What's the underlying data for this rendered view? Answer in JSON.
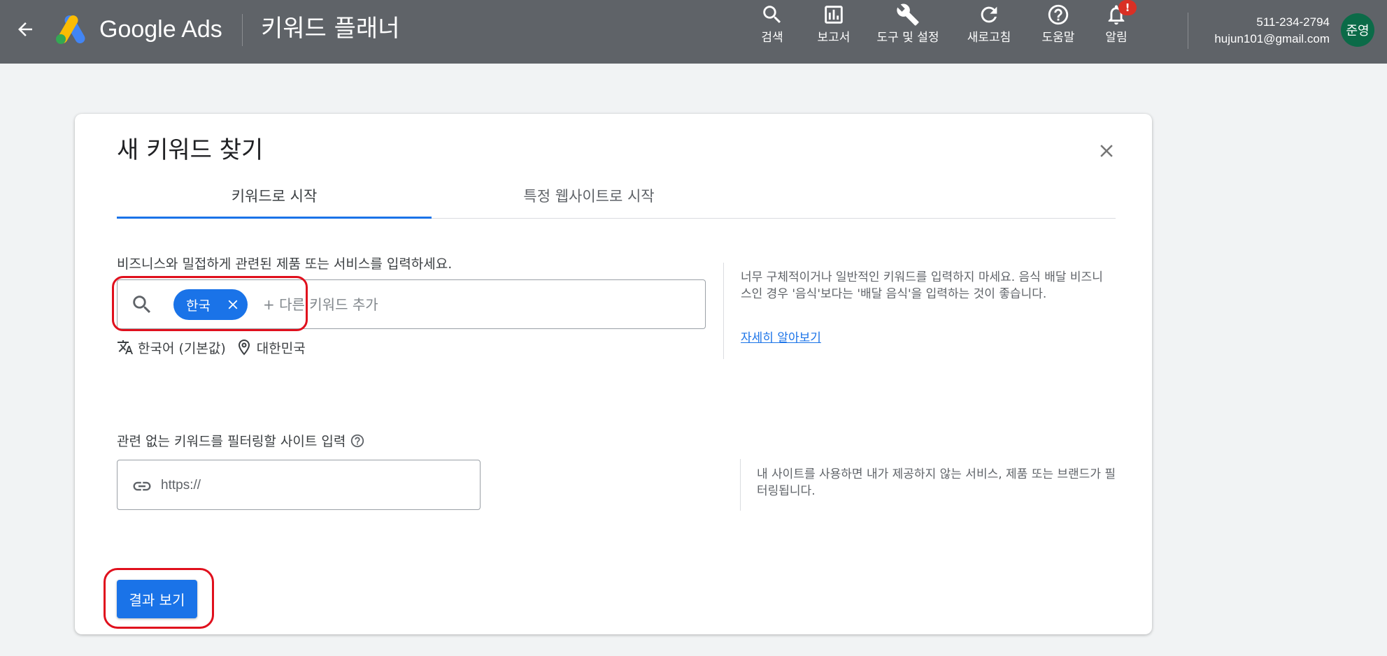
{
  "topbar": {
    "brand": "Google Ads",
    "product": "키워드 플래너",
    "tools": [
      {
        "label": "검색",
        "icon": "search-icon"
      },
      {
        "label": "보고서",
        "icon": "reports-icon"
      },
      {
        "label": "도구 및 설정",
        "icon": "wrench-icon"
      },
      {
        "label": "새로고침",
        "icon": "refresh-icon"
      },
      {
        "label": "도움말",
        "icon": "help-icon"
      },
      {
        "label": "알림",
        "icon": "bell-icon"
      }
    ],
    "alert_badge": "!",
    "account_phone": "511-234-2794",
    "account_email": "hujun101@gmail.com",
    "avatar_text": "준영",
    "colors": {
      "bar": "#5f6368",
      "avatar": "#0b6b48",
      "badge": "#d93025"
    }
  },
  "dialog": {
    "title": "새 키워드 찾기",
    "tabs": [
      {
        "label": "키워드로 시작",
        "active": true
      },
      {
        "label": "특정 웹사이트로 시작",
        "active": false
      }
    ],
    "keyword_section": {
      "label": "비즈니스와 밀접하게 관련된 제품 또는 서비스를 입력하세요.",
      "chip": "한국",
      "placeholder": "+ 다른 키워드 추가",
      "language": "한국어 (기본값)",
      "location": "대한민국",
      "help_text": "너무 구체적이거나 일반적인 키워드를 입력하지 마세요. 음식 배달 비즈니스인 경우 '음식'보다는 '배달 음식'을 입력하는 것이 좋습니다.",
      "learn_more": "자세히 알아보기"
    },
    "site_section": {
      "label": "관련 없는 키워드를 필터링할 사이트 입력",
      "placeholder": "https://",
      "help_text": "내 사이트를 사용하면 내가 제공하지 않는 서비스, 제품 또는 브랜드가 필터링됩니다."
    },
    "results_button": "결과 보기",
    "colors": {
      "accent": "#1a73e8",
      "annotation": "#e0101d"
    }
  }
}
